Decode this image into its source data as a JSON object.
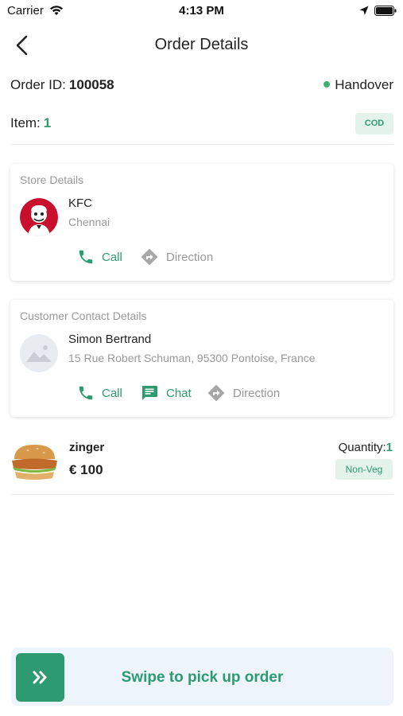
{
  "status_bar": {
    "carrier": "Carrier",
    "time": "4:13 PM"
  },
  "nav": {
    "title": "Order Details"
  },
  "order": {
    "id_label": "Order ID:",
    "id_value": "100058",
    "status": "Handover",
    "item_label": "Item:",
    "item_count": "1",
    "payment_badge": "COD"
  },
  "store": {
    "section_title": "Store Details",
    "name": "KFC",
    "city": "Chennai",
    "call_label": "Call",
    "direction_label": "Direction"
  },
  "customer": {
    "section_title": "Customer Contact Details",
    "name": "Simon Bertrand",
    "address": "15 Rue Robert Schuman, 95300 Pontoise, France",
    "call_label": "Call",
    "chat_label": "Chat",
    "direction_label": "Direction"
  },
  "item": {
    "name": "zinger",
    "price": "€ 100",
    "quantity_label": "Quantity:",
    "quantity_value": "1",
    "type_badge": "Non-Veg"
  },
  "swipe": {
    "label": "Swipe to pick up order"
  },
  "colors": {
    "accent": "#2e9a6f",
    "badge_bg": "#e3f3ea",
    "swipe_bg": "#eef4fb"
  }
}
